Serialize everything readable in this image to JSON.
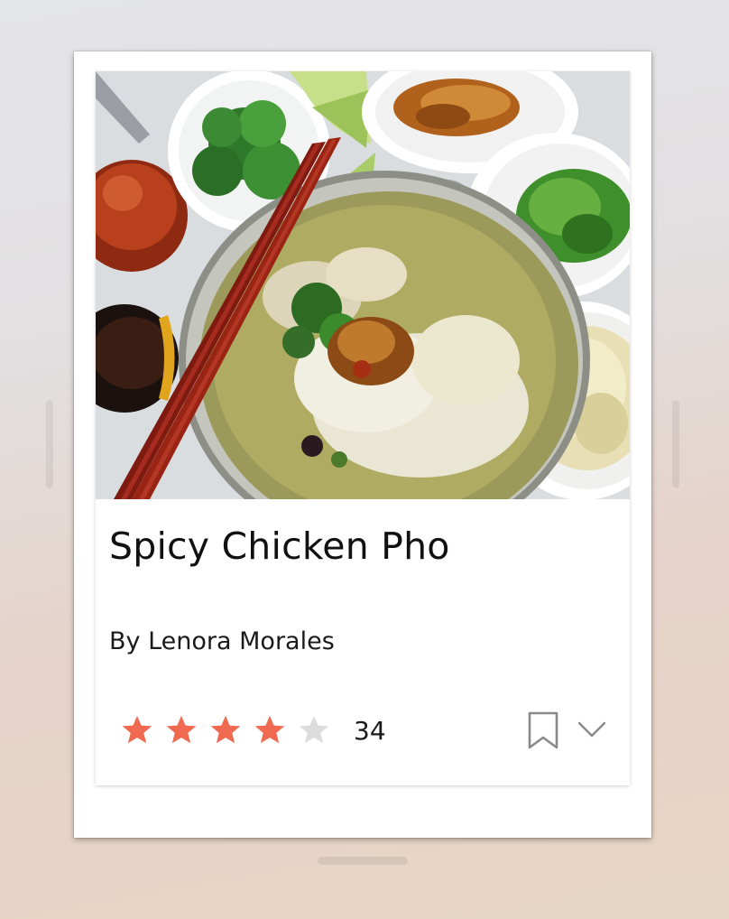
{
  "recipe": {
    "title": "Spicy Chicken Pho",
    "author": "By Lenora Morales",
    "rating": 4,
    "rating_max": 5,
    "rating_count": "34",
    "photo_subject": "bowl of chicken pho with chopsticks, lime, cilantro, bean sprouts and scallions"
  },
  "icons": {
    "star": "star-icon",
    "bookmark": "bookmark-icon",
    "expand": "chevron-down-icon"
  },
  "colors": {
    "star_filled": "#ef6a50",
    "star_empty": "#dcdcdc",
    "icon_gray": "#8a8a8a",
    "text": "#111111"
  }
}
